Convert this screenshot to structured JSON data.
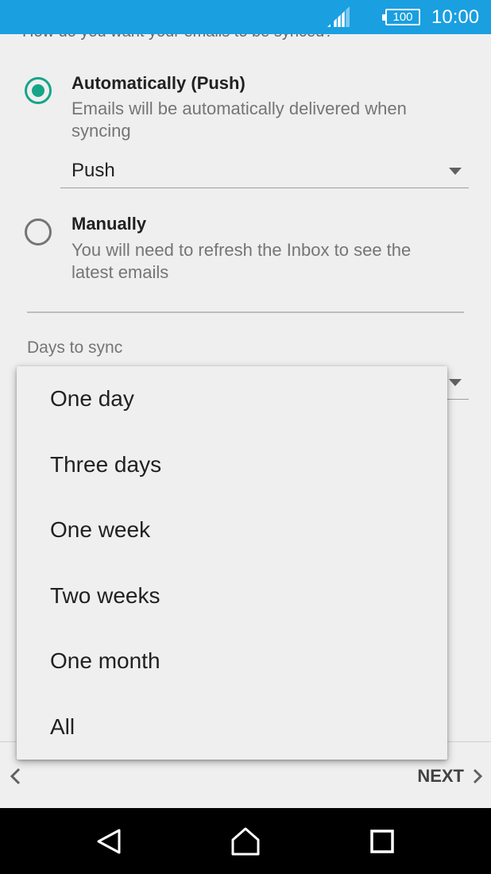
{
  "status_bar": {
    "battery": "100",
    "time": "10:00",
    "icons": [
      "signal-icon",
      "battery-icon"
    ],
    "color": "#1a9fe0"
  },
  "sync": {
    "question": "How do you want your emails to be synced?",
    "options": [
      {
        "title": "Automatically (Push)",
        "description": "Emails will be automatically delivered when syncing",
        "selected": true
      },
      {
        "title": "Manually",
        "description": "You will need to refresh the Inbox to see the latest emails",
        "selected": false
      }
    ],
    "push_select": {
      "value": "Push"
    },
    "accent_color": "#16a589"
  },
  "days_to_sync": {
    "label": "Days to sync",
    "options": [
      "One day",
      "Three days",
      "One week",
      "Two weeks",
      "One month",
      "All"
    ]
  },
  "bottom_bar": {
    "next_label": "NEXT",
    "icons": [
      "chevron-left-icon",
      "chevron-right-icon"
    ]
  },
  "nav_bar": {
    "icons": [
      "back-icon",
      "home-icon",
      "recents-icon"
    ]
  }
}
